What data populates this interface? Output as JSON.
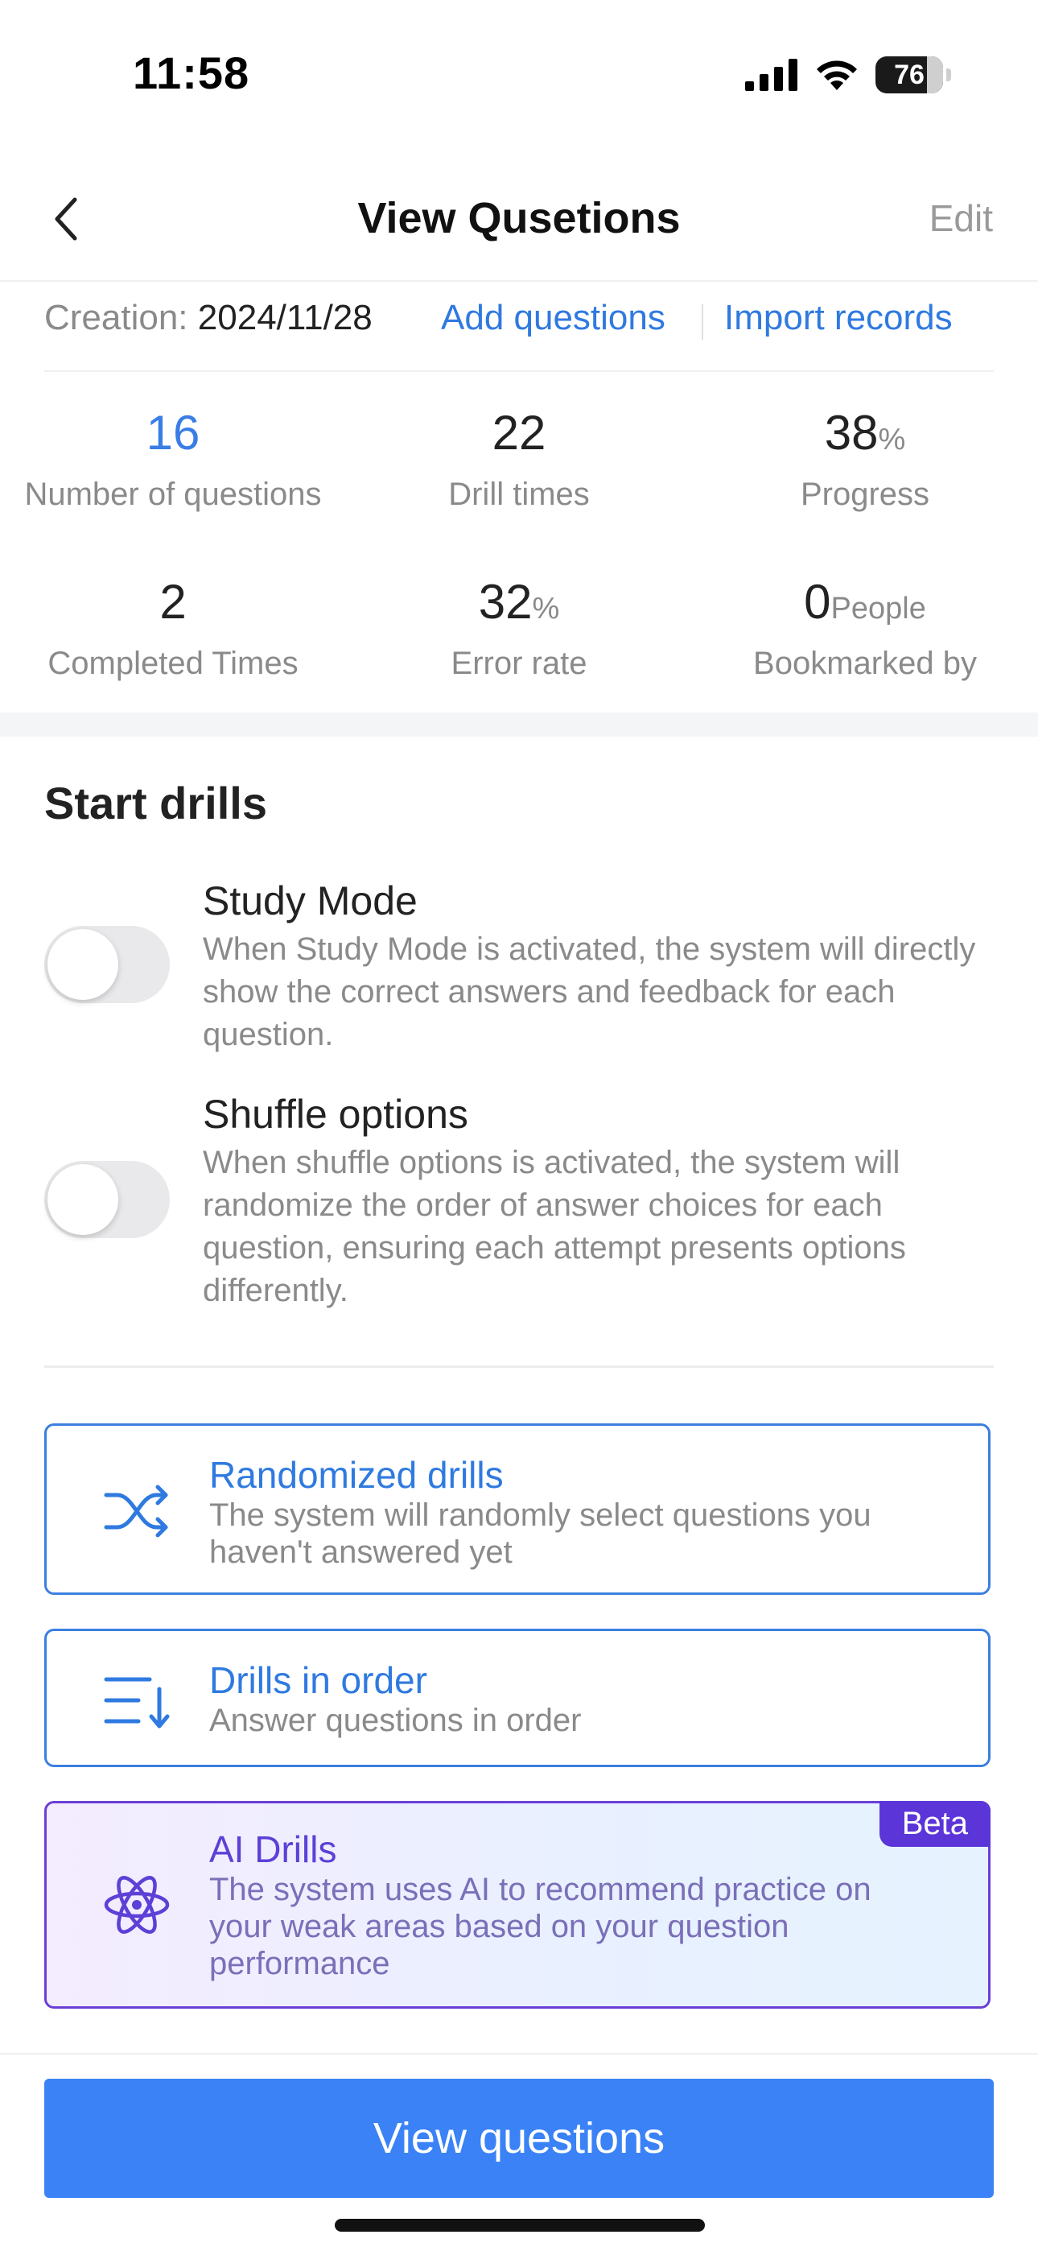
{
  "status_bar": {
    "time": "11:58",
    "battery": "76"
  },
  "nav": {
    "title": "View Qusetions",
    "edit": "Edit"
  },
  "info": {
    "creation_label": "Creation:",
    "creation_date": "2024/11/28",
    "add_questions": "Add questions",
    "import_records": "Import records"
  },
  "stats": [
    {
      "value": "16",
      "unit": "",
      "label": "Number of questions"
    },
    {
      "value": "22",
      "unit": "",
      "label": "Drill times"
    },
    {
      "value": "38",
      "unit": "%",
      "label": "Progress"
    },
    {
      "value": "2",
      "unit": "",
      "label": "Completed Times"
    },
    {
      "value": "32",
      "unit": "%",
      "label": "Error rate"
    },
    {
      "value": "0",
      "unit": "People",
      "label": "Bookmarked by"
    }
  ],
  "section": {
    "title": "Start drills"
  },
  "options": [
    {
      "title": "Study Mode",
      "desc": "When Study Mode is activated, the system will directly show the correct answers and feedback for each question.",
      "enabled": false
    },
    {
      "title": "Shuffle options",
      "desc": "When shuffle options is activated, the system will randomize the order of answer choices for each question, ensuring each attempt presents options differently.",
      "enabled": false
    }
  ],
  "modes": [
    {
      "title": "Randomized drills",
      "desc": "The system will randomly select questions you haven't answered yet",
      "icon": "shuffle-icon"
    },
    {
      "title": "Drills in order",
      "desc": "Answer questions in order",
      "icon": "ordered-list-icon"
    },
    {
      "title": "AI Drills",
      "desc": "The system uses AI to recommend practice on your weak areas based on your question performance",
      "icon": "atom-icon",
      "badge": "Beta"
    }
  ],
  "footer": {
    "button": "View questions"
  },
  "colors": {
    "accent": "#3a82f6",
    "link": "#2f7ae0",
    "ai": "#5b35d8"
  }
}
